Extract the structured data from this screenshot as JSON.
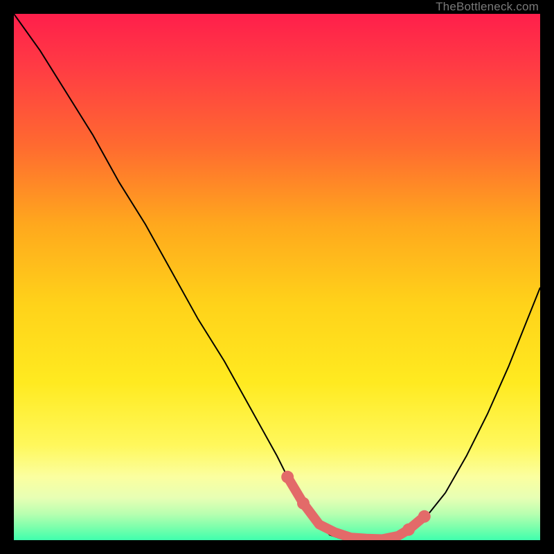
{
  "watermark": "TheBottleneck.com",
  "colors": {
    "black": "#000000",
    "curve": "#000000",
    "marker": "#e36a69",
    "gradient_stops": [
      {
        "offset": 0.0,
        "color": "#ff1f4b"
      },
      {
        "offset": 0.1,
        "color": "#ff3b44"
      },
      {
        "offset": 0.25,
        "color": "#ff6a30"
      },
      {
        "offset": 0.4,
        "color": "#ffa81d"
      },
      {
        "offset": 0.55,
        "color": "#ffd21a"
      },
      {
        "offset": 0.7,
        "color": "#ffea20"
      },
      {
        "offset": 0.82,
        "color": "#fff85c"
      },
      {
        "offset": 0.88,
        "color": "#fbffa0"
      },
      {
        "offset": 0.92,
        "color": "#e7ffb4"
      },
      {
        "offset": 0.95,
        "color": "#b8ffb0"
      },
      {
        "offset": 0.975,
        "color": "#7dffac"
      },
      {
        "offset": 1.0,
        "color": "#3fffad"
      }
    ]
  },
  "chart_data": {
    "type": "line",
    "title": "",
    "xlabel": "",
    "ylabel": "",
    "xlim": [
      0,
      100
    ],
    "ylim": [
      0,
      100
    ],
    "grid": false,
    "series": [
      {
        "name": "bottleneck-curve",
        "x": [
          0,
          5,
          10,
          15,
          20,
          25,
          30,
          35,
          40,
          45,
          50,
          52,
          55,
          58,
          60,
          63,
          66,
          70,
          74,
          78,
          82,
          86,
          90,
          94,
          98,
          100
        ],
        "y": [
          100,
          93,
          85,
          77,
          68,
          60,
          51,
          42,
          34,
          25,
          16,
          12,
          7,
          3,
          1,
          0,
          0,
          0,
          1,
          4,
          9,
          16,
          24,
          33,
          43,
          48
        ]
      }
    ],
    "markers": {
      "name": "highlight-band",
      "x": [
        52,
        55,
        58,
        61,
        64,
        67,
        70,
        73,
        75,
        78
      ],
      "y": [
        12,
        7,
        3,
        1.5,
        0.5,
        0.3,
        0.2,
        0.8,
        2,
        4.5
      ]
    }
  }
}
